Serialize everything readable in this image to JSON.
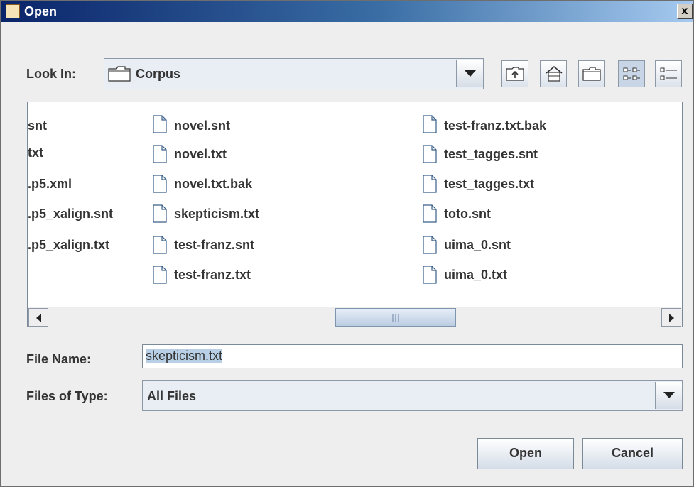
{
  "window": {
    "title": "Open",
    "close_label": "x"
  },
  "look_in": {
    "label": "Look In:",
    "value": "Corpus"
  },
  "toolbar": [
    "up-folder",
    "home",
    "new-folder",
    "list-view",
    "details-view"
  ],
  "files": {
    "col1": [
      "snt",
      "txt",
      ".p5.xml",
      ".p5_xalign.snt",
      ".p5_xalign.txt"
    ],
    "col2": [
      "novel.snt",
      "novel.txt",
      "novel.txt.bak",
      "skepticism.txt",
      "test-franz.snt",
      "test-franz.txt"
    ],
    "col3": [
      "test-franz.txt.bak",
      "test_tagges.snt",
      "test_tagges.txt",
      "toto.snt",
      "uima_0.snt",
      "uima_0.txt"
    ]
  },
  "file_name": {
    "label": "File Name:",
    "value": "skepticism.txt"
  },
  "files_of_type": {
    "label": "Files of Type:",
    "value": "All Files"
  },
  "buttons": {
    "open": "Open",
    "cancel": "Cancel"
  }
}
